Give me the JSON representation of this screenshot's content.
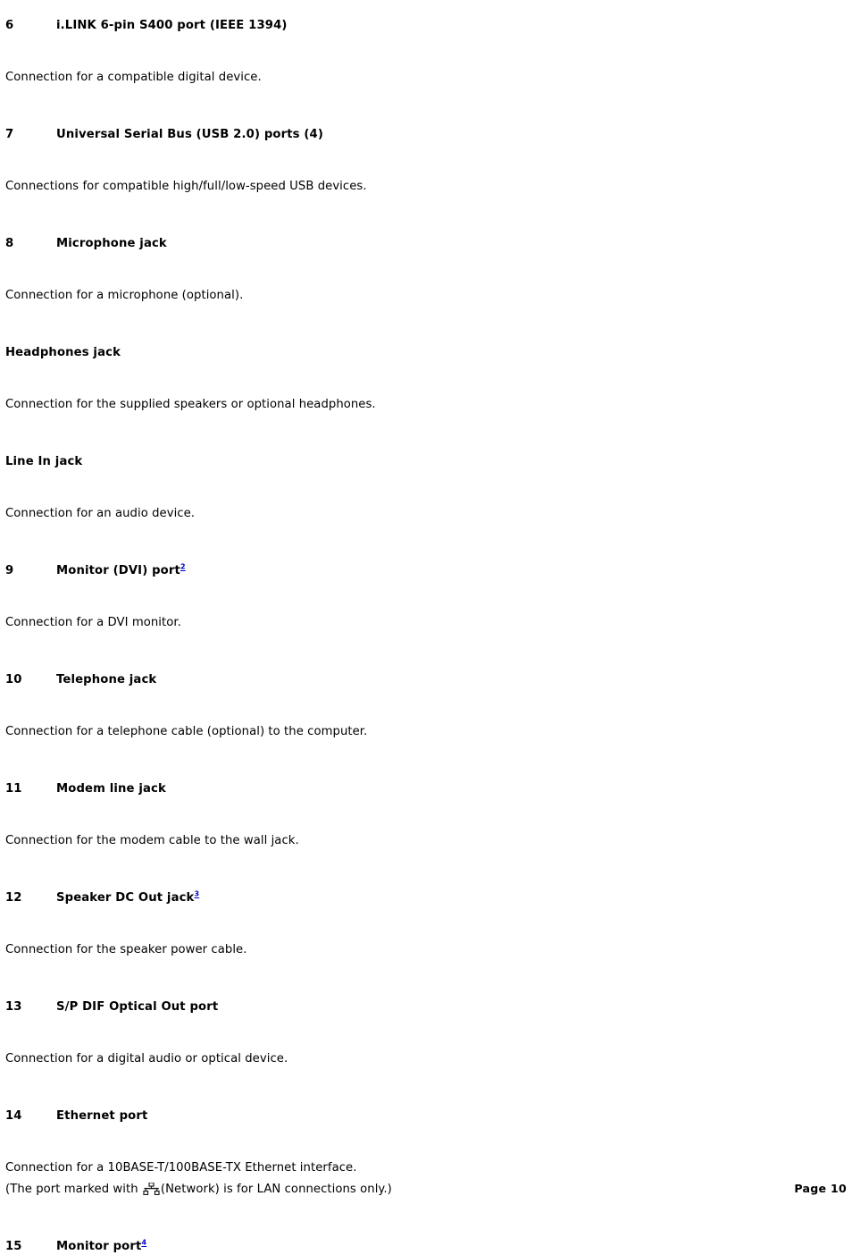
{
  "page": {
    "footer_label": "Page 10",
    "link_color": "#0000cc",
    "text_color": "#000000",
    "background_color": "#ffffff"
  },
  "entries": [
    {
      "number": "6",
      "title": "i.LINK 6-pin S400 port (IEEE 1394)",
      "footnote": "",
      "body": "Connection for a compatible digital device."
    },
    {
      "number": "7",
      "title": "Universal Serial Bus (USB 2.0) ports (4)",
      "footnote": "",
      "body": "Connections for compatible high/full/low-speed USB devices."
    },
    {
      "number": "8",
      "title": "Microphone jack",
      "footnote": "",
      "body": "Connection for a microphone (optional)."
    },
    {
      "number": "",
      "title": "Headphones jack",
      "footnote": "",
      "body": "Connection for the supplied speakers or optional headphones."
    },
    {
      "number": "",
      "title": "Line In jack",
      "footnote": "",
      "body": "Connection for an audio device."
    },
    {
      "number": "9",
      "title": "Monitor (DVI) port",
      "footnote": "2",
      "body": "Connection for a DVI monitor."
    },
    {
      "number": "10",
      "title": "Telephone jack",
      "footnote": "",
      "body": "Connection for a telephone cable (optional) to the computer."
    },
    {
      "number": "11",
      "title": "Modem line jack",
      "footnote": "",
      "body": "Connection for the modem cable to the wall jack."
    },
    {
      "number": "12",
      "title": "Speaker DC Out jack",
      "footnote": "3",
      "body": "Connection for the speaker power cable."
    },
    {
      "number": "13",
      "title": "S/P DIF Optical Out port",
      "footnote": "",
      "body": "Connection for a digital audio or optical device."
    }
  ],
  "ethernet": {
    "number": "14",
    "title": "Ethernet port",
    "footnote": "",
    "body_line1": "Connection for a 10BASE-T/100BASE-TX Ethernet interface.",
    "body_line2_before_icon": "(The port marked with ",
    "icon_name": "network-icon",
    "body_line2_after_icon": "(Network) is for LAN connections only.)"
  },
  "last_entry": {
    "number": "15",
    "title": "Monitor port",
    "footnote": "4"
  }
}
